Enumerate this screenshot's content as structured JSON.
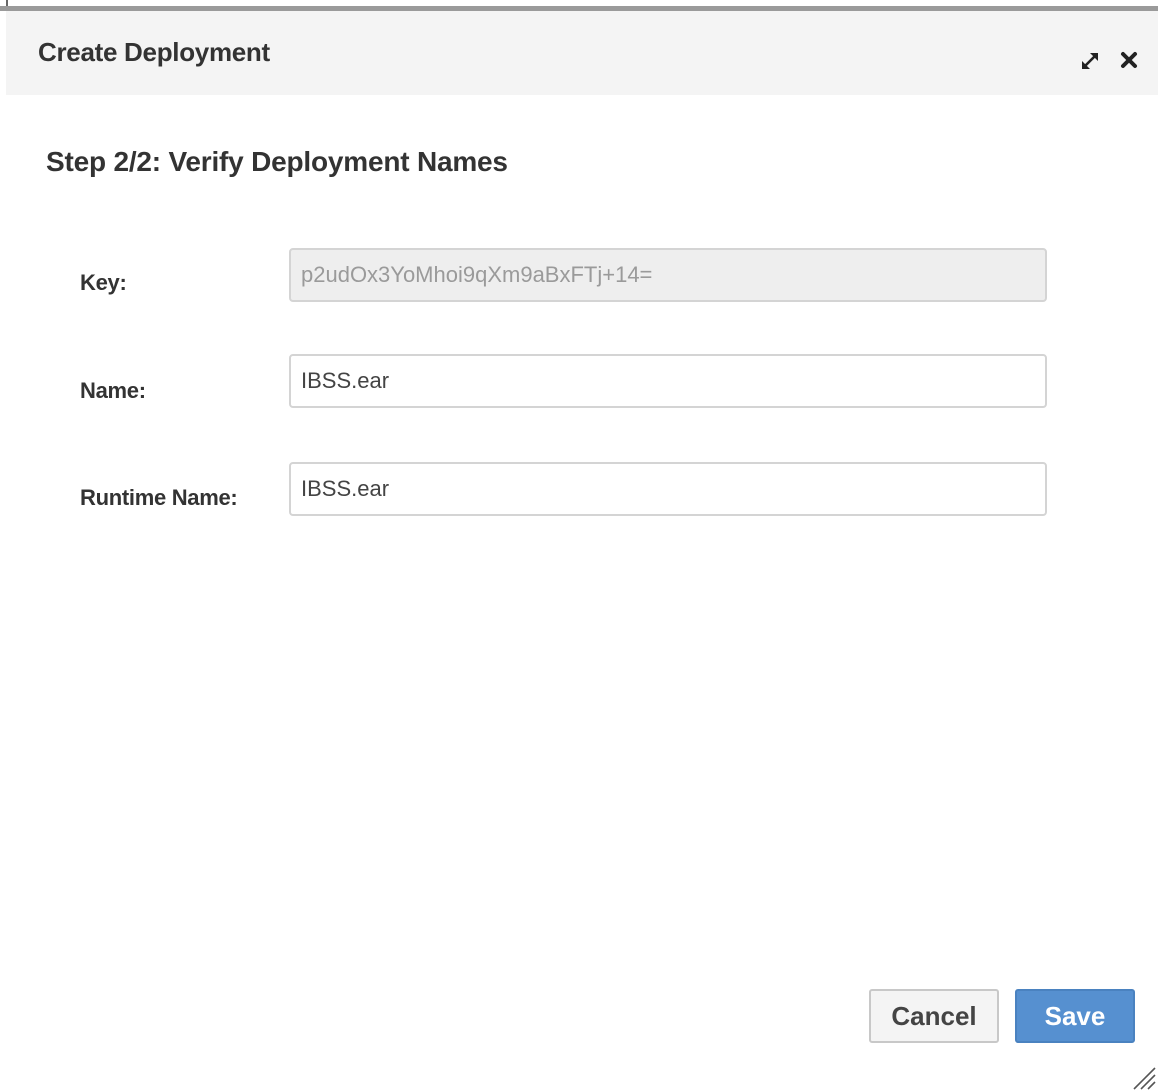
{
  "dialog": {
    "title": "Create Deployment",
    "maximize_icon": "maximize-icon",
    "close_icon": "close-icon"
  },
  "step": {
    "heading": "Step 2/2: Verify Deployment Names"
  },
  "form": {
    "key": {
      "label": "Key:",
      "value": "p2udOx3YoMhoi9qXm9aBxFTj+14=",
      "readonly": true
    },
    "name": {
      "label": "Name:",
      "value": "IBSS.ear"
    },
    "runtime_name": {
      "label": "Runtime Name:",
      "value": "IBSS.ear"
    }
  },
  "footer": {
    "cancel_label": "Cancel",
    "save_label": "Save"
  },
  "colors": {
    "primary_button": "#5690d0",
    "title_bar_bg": "#f4f4f4",
    "readonly_input_bg": "#eeeeee"
  }
}
